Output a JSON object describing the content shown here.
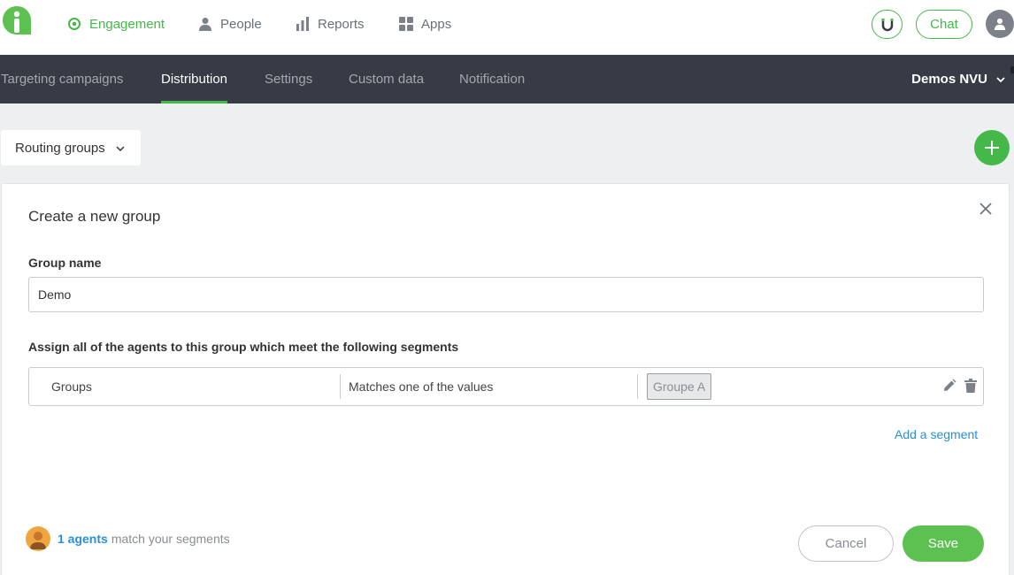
{
  "topnav": {
    "items": [
      {
        "label": "Engagement",
        "icon": "target-icon",
        "active": true
      },
      {
        "label": "People",
        "icon": "person-icon",
        "active": false
      },
      {
        "label": "Reports",
        "icon": "bar-chart-icon",
        "active": false
      },
      {
        "label": "Apps",
        "icon": "grid-icon",
        "active": false
      }
    ],
    "chat_label": "Chat"
  },
  "subnav": {
    "tabs": [
      {
        "label": "Targeting campaigns",
        "active": false
      },
      {
        "label": "Distribution",
        "active": true
      },
      {
        "label": "Settings",
        "active": false
      },
      {
        "label": "Custom data",
        "active": false
      },
      {
        "label": "Notification",
        "active": false
      }
    ],
    "account_name": "Demos NVU"
  },
  "routing": {
    "label": "Routing groups"
  },
  "form": {
    "title": "Create a new group",
    "group_name_label": "Group name",
    "group_name_value": "Demo",
    "assign_label": "Assign all of the agents to this group which meet the following segments",
    "segment": {
      "field": "Groups",
      "operator": "Matches one of the values",
      "value_tag": "Groupe A"
    },
    "add_segment_label": "Add a segment",
    "agents_link": "1 agents",
    "agents_text": "match your segments",
    "cancel_label": "Cancel",
    "save_label": "Save"
  },
  "colors": {
    "brand_green": "#45b84a",
    "subnav_bg": "#363b45",
    "link_blue": "#2b8fd6"
  }
}
